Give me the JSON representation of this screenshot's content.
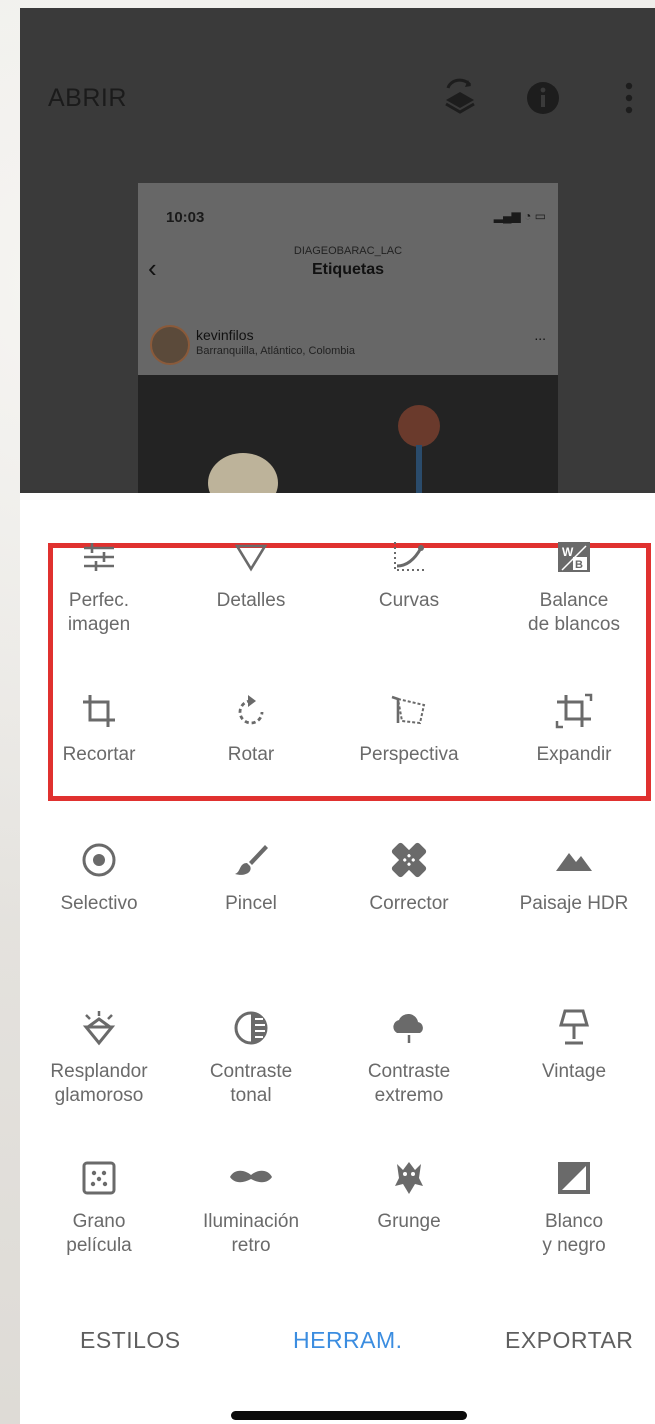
{
  "header": {
    "open_label": "ABRIR"
  },
  "preview": {
    "time": "10:03",
    "account": "DIAGEOBARAC_LAC",
    "title": "Etiquetas",
    "username": "kevinfilos",
    "location": "Barranquilla, Atlántico, Colombia",
    "more": "..."
  },
  "tools": [
    {
      "label": "Perfec.\nimagen",
      "icon": "tune-icon"
    },
    {
      "label": "Detalles",
      "icon": "triangle-down-icon"
    },
    {
      "label": "Curvas",
      "icon": "curves-icon"
    },
    {
      "label": "Balance\nde blancos",
      "icon": "white-balance-icon"
    },
    {
      "label": "Recortar",
      "icon": "crop-icon"
    },
    {
      "label": "Rotar",
      "icon": "rotate-icon"
    },
    {
      "label": "Perspectiva",
      "icon": "perspective-icon"
    },
    {
      "label": "Expandir",
      "icon": "expand-icon"
    },
    {
      "label": "Selectivo",
      "icon": "selective-icon"
    },
    {
      "label": "Pincel",
      "icon": "brush-icon"
    },
    {
      "label": "Corrector",
      "icon": "healing-icon"
    },
    {
      "label": "Paisaje HDR",
      "icon": "mountains-icon"
    },
    {
      "label": "Resplandor\nglamoroso",
      "icon": "diamond-icon"
    },
    {
      "label": "Contraste\ntonal",
      "icon": "tonal-contrast-icon"
    },
    {
      "label": "Contraste\nextremo",
      "icon": "drama-cloud-icon"
    },
    {
      "label": "Vintage",
      "icon": "lamp-icon"
    },
    {
      "label": "Grano\npelícula",
      "icon": "grain-icon"
    },
    {
      "label": "Iluminación\nretro",
      "icon": "mustache-icon"
    },
    {
      "label": "Grunge",
      "icon": "grunge-icon"
    },
    {
      "label": "Blanco\ny negro",
      "icon": "black-white-icon"
    }
  ],
  "tabs": {
    "styles": "ESTILOS",
    "tools": "HERRAM.",
    "export": "EXPORTAR"
  },
  "colors": {
    "accent": "#3b8de0",
    "highlight": "#e0312f",
    "icon": "#6a6a6a"
  }
}
